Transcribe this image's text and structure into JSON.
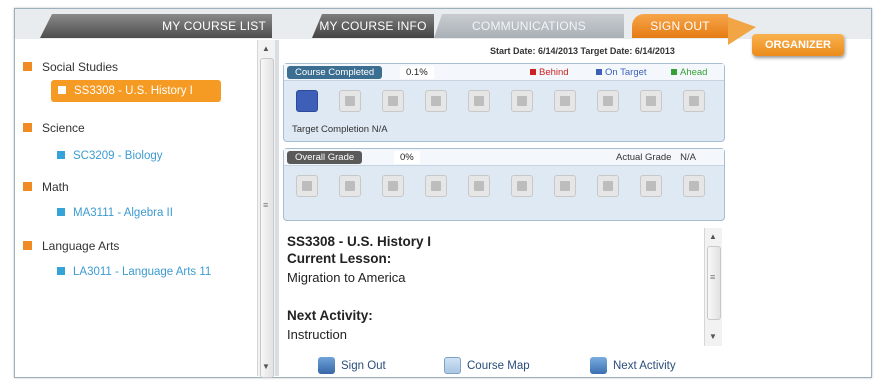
{
  "tabs": {
    "my_course_list": "MY COURSE LIST",
    "my_course_info": "MY COURSE INFO",
    "communications": "COMMUNICATIONS",
    "sign_out": "SIGN OUT"
  },
  "organizer": {
    "label": "ORGANIZER"
  },
  "sidebar": {
    "subjects": [
      {
        "name": "Social Studies",
        "course": "SS3308 - U.S. History I",
        "selected": true
      },
      {
        "name": "Science",
        "course": "SC3209 - Biology",
        "selected": false
      },
      {
        "name": "Math",
        "course": "MA3111 - Algebra II",
        "selected": false
      },
      {
        "name": "Language Arts",
        "course": "LA3011 - Language Arts 11",
        "selected": false
      }
    ]
  },
  "dates": {
    "text": "Start Date: 6/14/2013  Target Date: 6/14/2013"
  },
  "completion": {
    "label": "Course Completed",
    "value": "0.1%",
    "legend": {
      "behind": "Behind",
      "on_target": "On Target",
      "ahead": "Ahead"
    },
    "tiles_done": 1,
    "tiles_total": 10,
    "target_completion_label": "Target Completion",
    "target_completion_value": "N/A"
  },
  "grade": {
    "label": "Overall Grade",
    "value": "0%",
    "actual_label": "Actual Grade",
    "actual_value": "N/A",
    "tiles_total": 10
  },
  "lesson": {
    "course_title": "SS3308 - U.S. History I",
    "current_lesson_heading": "Current Lesson:",
    "current_lesson": "Migration to America",
    "next_activity_heading": "Next Activity:",
    "next_activity": "Instruction"
  },
  "footer": {
    "sign_out": "Sign Out",
    "course_map": "Course Map",
    "next_activity": "Next Activity"
  },
  "colors": {
    "accent_orange": "#f59a22",
    "course_blue": "#3d9bd2",
    "behind": "#cc2222",
    "on_target": "#3d5fb7",
    "ahead": "#35a035"
  }
}
